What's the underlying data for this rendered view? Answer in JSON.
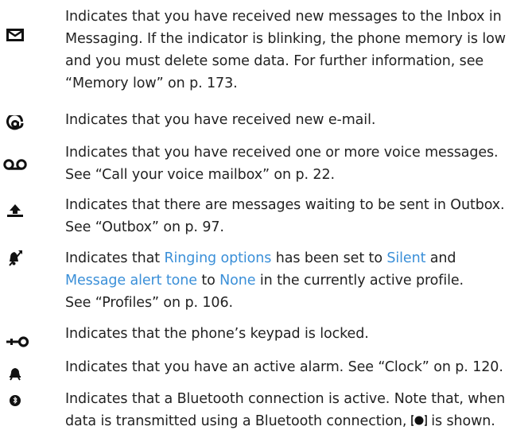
{
  "entries": [
    {
      "icon": "envelope-icon",
      "text": "Indicates that you have received new messages to the Inbox in Messaging. If the indicator is blinking, the phone memory is low and you must delete some data. For further information, see “Memory low” on p. 173."
    },
    {
      "icon": "at-sign-icon",
      "text": "Indicates that you have received new e-mail."
    },
    {
      "icon": "voicemail-icon",
      "line1": "Indicates that you have received one or more voice messages.",
      "line2": "See “Call your voice mailbox” on p. 22."
    },
    {
      "icon": "outbox-upload-icon",
      "line1": "Indicates that there are messages waiting to be sent in Outbox.",
      "line2": "See “Outbox” on p. 97."
    },
    {
      "icon": "silent-bell-icon",
      "t1": "Indicates that ",
      "link1": "Ringing options",
      "t2": " has been set to ",
      "link2": "Silent",
      "t3": " and",
      "link3": "Message alert tone",
      "t4": " to ",
      "link4": "None",
      "t5": " in the currently active profile.",
      "line3": "See “Profiles” on p. 106.",
      "link_color": "#3a8fd8"
    },
    {
      "icon": "keypad-lock-key-icon",
      "text": "Indicates that the phone’s keypad is locked."
    },
    {
      "icon": "alarm-clock-icon",
      "text": "Indicates that you have an active alarm. See “Clock” on p. 120."
    },
    {
      "icon": "bluetooth-icon",
      "t1": "Indicates that a Bluetooth connection is active. Note that, when data is transmitted using a Bluetooth connection, ",
      "inline_icon": "bluetooth-transmitting-icon",
      "t2": " is shown."
    }
  ]
}
